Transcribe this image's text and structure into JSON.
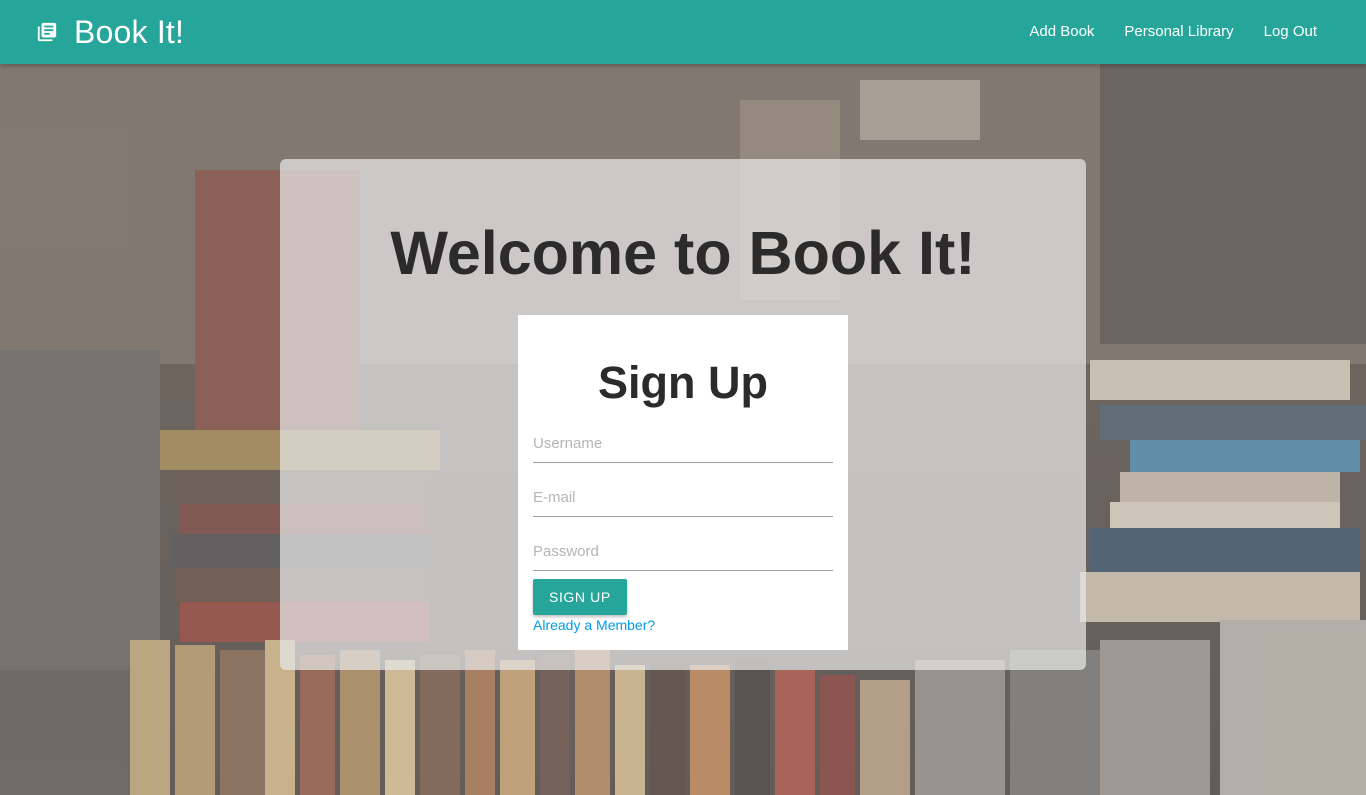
{
  "navbar": {
    "brand_icon": "library-books-icon",
    "brand": "Book It!",
    "links": [
      "Add Book",
      "Personal Library",
      "Log Out"
    ]
  },
  "hero": {
    "title": "Welcome to Book It!"
  },
  "signup": {
    "title": "Sign Up",
    "username_placeholder": "Username",
    "email_placeholder": "E-mail",
    "password_placeholder": "Password",
    "submit_label": "SIGN UP",
    "member_link": "Already a Member?"
  },
  "colors": {
    "accent": "#26a69a",
    "link": "#039be5"
  }
}
